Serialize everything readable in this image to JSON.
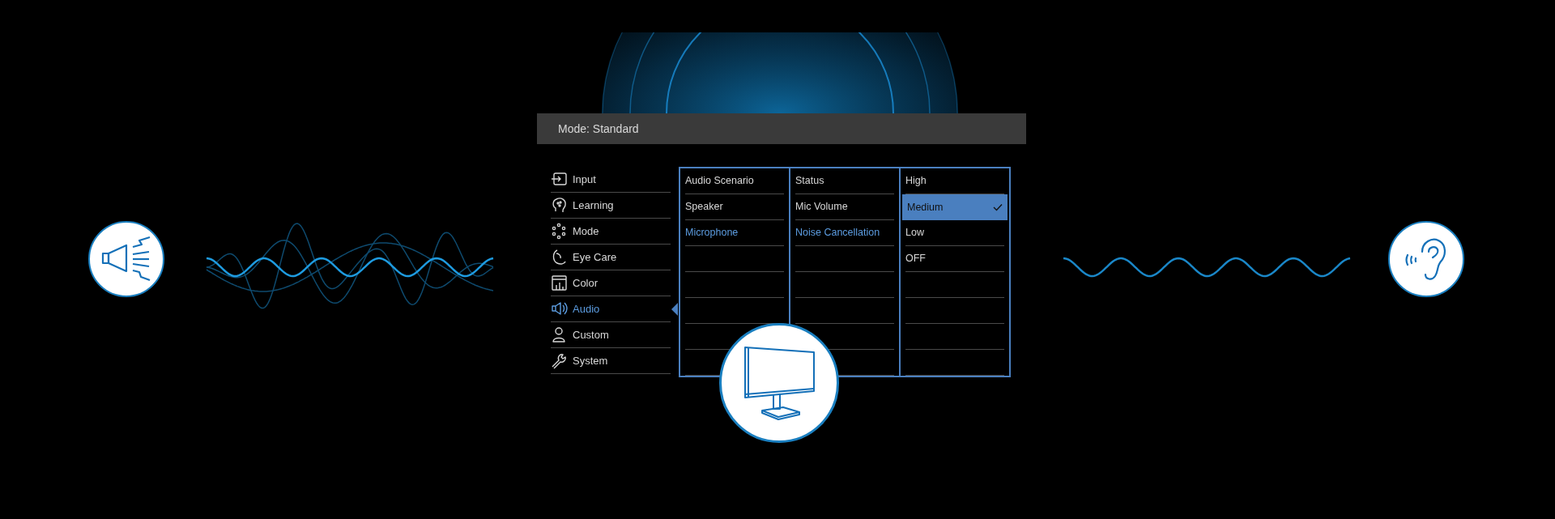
{
  "header": {
    "title": "Mode: Standard"
  },
  "sidebar": {
    "items": [
      {
        "label": "Input",
        "selected": false
      },
      {
        "label": "Learning",
        "selected": false
      },
      {
        "label": "Mode",
        "selected": false
      },
      {
        "label": "Eye Care",
        "selected": false
      },
      {
        "label": "Color",
        "selected": false
      },
      {
        "label": "Audio",
        "selected": true
      },
      {
        "label": "Custom",
        "selected": false
      },
      {
        "label": "System",
        "selected": false
      }
    ]
  },
  "columns": [
    {
      "kind": "submenu",
      "items": [
        {
          "label": "Audio Scenario",
          "selected": false
        },
        {
          "label": "Speaker",
          "selected": false
        },
        {
          "label": "Microphone",
          "selected": true
        }
      ]
    },
    {
      "kind": "submenu",
      "items": [
        {
          "label": "Status",
          "selected": false
        },
        {
          "label": "Mic Volume",
          "selected": false
        },
        {
          "label": "Noise Cancellation",
          "selected": true
        }
      ]
    },
    {
      "kind": "options",
      "items": [
        {
          "label": "High",
          "selected": false,
          "checked": false
        },
        {
          "label": "Medium",
          "selected": true,
          "checked": true
        },
        {
          "label": "Low",
          "selected": false,
          "checked": false
        },
        {
          "label": "OFF",
          "selected": false,
          "checked": false
        }
      ]
    }
  ]
}
